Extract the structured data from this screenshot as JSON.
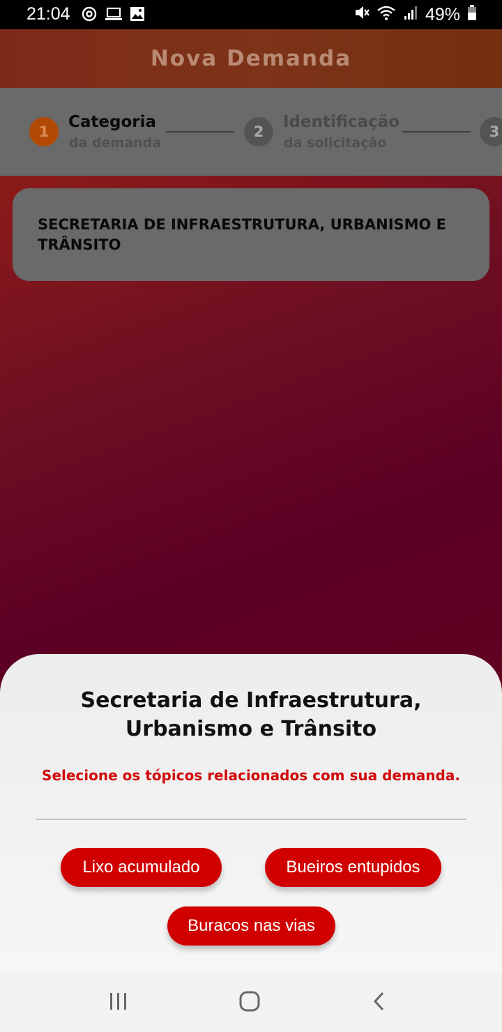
{
  "status_bar": {
    "time": "21:04",
    "battery_text": "49%",
    "icons": [
      "sync-icon",
      "laptop-icon",
      "image-icon",
      "mute-icon",
      "wifi-icon",
      "signal-icon",
      "battery-icon"
    ]
  },
  "header": {
    "title": "Nova Demanda"
  },
  "stepper": {
    "steps": [
      {
        "number": "1",
        "title": "Categoria",
        "subtitle": "da demanda",
        "active": true
      },
      {
        "number": "2",
        "title": "Identificação",
        "subtitle": "da solicitação",
        "active": false
      },
      {
        "number": "3",
        "title": "",
        "subtitle": "",
        "active": false
      }
    ]
  },
  "category_card": {
    "text": "SECRETARIA DE INFRAESTRUTURA, URBANISMO E TRÂNSITO"
  },
  "sheet": {
    "title_line1": "Secretaria de Infraestrutura,",
    "title_line2": "Urbanismo e Trânsito",
    "subtitle": "Selecione os tópicos relacionados com sua demanda.",
    "topics": [
      "Lixo acumulado",
      "Bueiros entupidos",
      "Buracos nas vias"
    ]
  },
  "colors": {
    "accent": "#d00000",
    "active_step": "#b24a05",
    "subtitle_red": "#d10a0a"
  },
  "nav_bar": {
    "icons": [
      "recent-apps-icon",
      "home-icon",
      "back-icon"
    ]
  }
}
